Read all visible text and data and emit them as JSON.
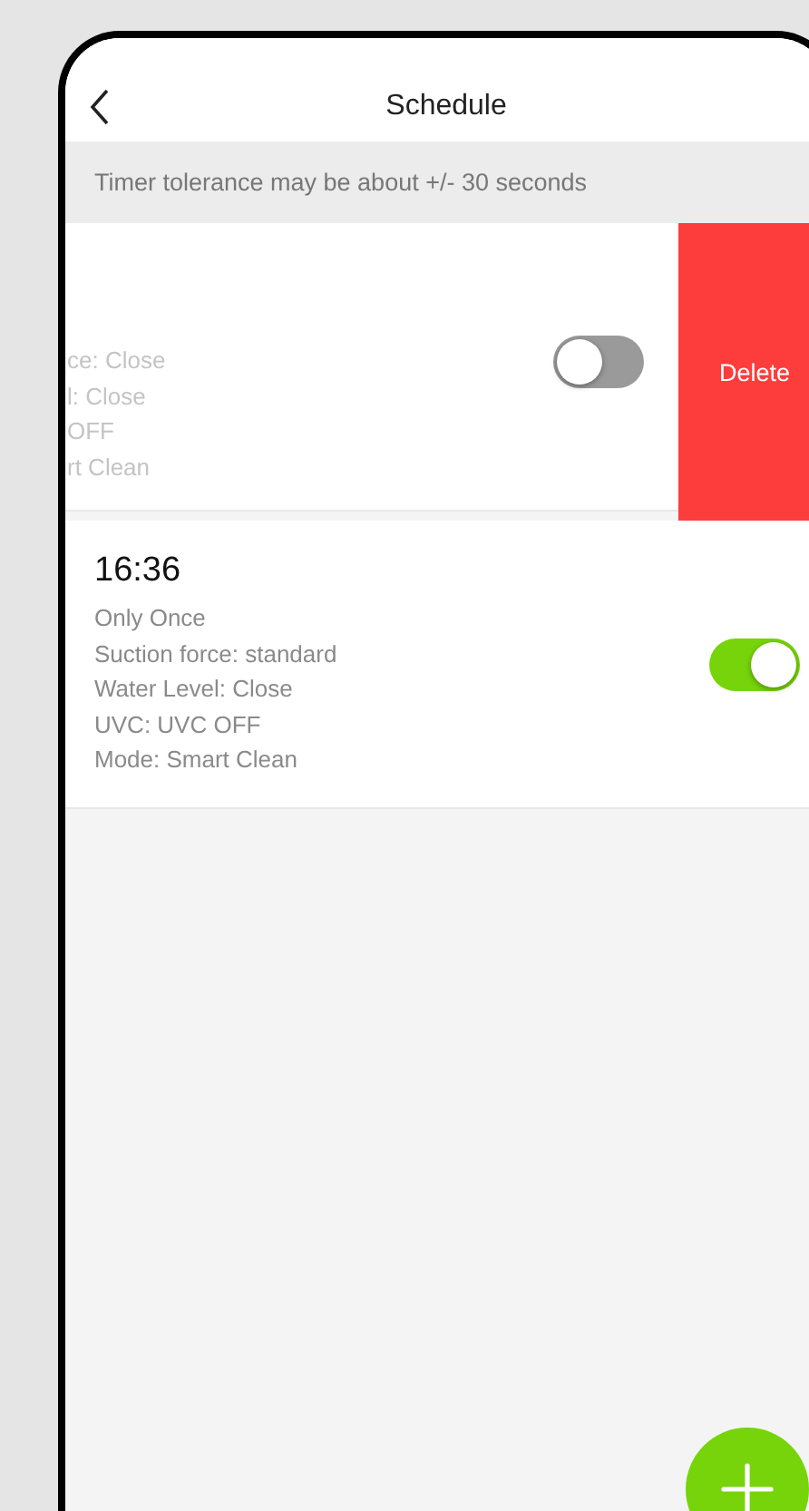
{
  "header": {
    "title": "Schedule"
  },
  "notice": "Timer tolerance may be about +/- 30 seconds",
  "schedules": [
    {
      "swiped": true,
      "delete_label": "Delete",
      "details": [
        "ce: Close",
        "l: Close",
        "OFF",
        "rt Clean"
      ],
      "on": false
    },
    {
      "swiped": false,
      "time": "16:36",
      "details": [
        "Only Once",
        "Suction force: standard",
        "Water Level: Close",
        "UVC: UVC OFF",
        "Mode: Smart Clean"
      ],
      "on": true
    }
  ]
}
